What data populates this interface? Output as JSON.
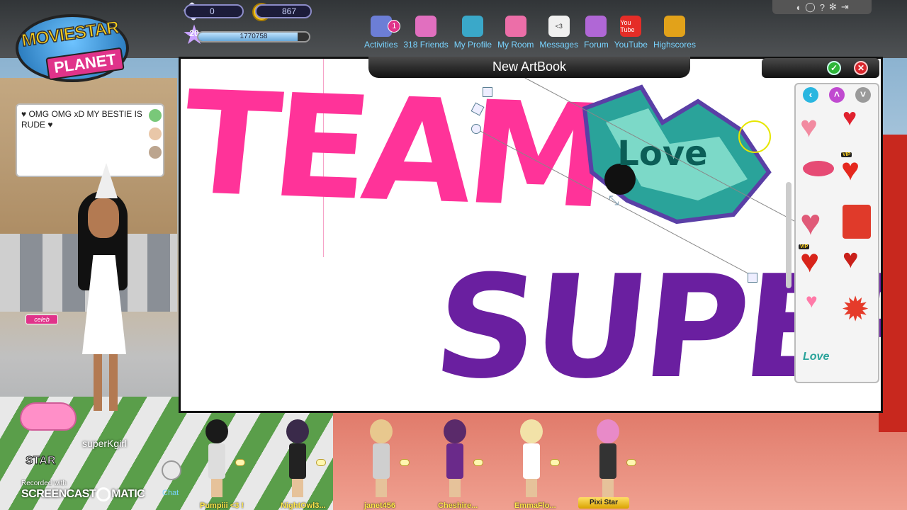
{
  "hud": {
    "logo_line1": "MOVIESTAR",
    "logo_line2": "PLANET",
    "diamonds": "0",
    "coins": "867",
    "level": "20",
    "fame": "1770758",
    "fame_progress": 0.9
  },
  "nav": {
    "items": [
      {
        "label": "Activities",
        "icon": "checklist-icon",
        "color": "#6c7ed6",
        "badge": "1"
      },
      {
        "label": "318 Friends",
        "icon": "friends-icon",
        "color": "#e16fbf"
      },
      {
        "label": "My Profile",
        "icon": "profile-book-icon",
        "color": "#3aa8c9"
      },
      {
        "label": "My Room",
        "icon": "house-icon",
        "color": "#ec6ea8"
      },
      {
        "label": "Messages",
        "icon": "speech-bubble-icon",
        "color": "#f0f0f0",
        "glyph": "<3"
      },
      {
        "label": "Forum",
        "icon": "forum-icon",
        "color": "#b067d6"
      },
      {
        "label": "YouTube",
        "icon": "youtube-icon",
        "color": "#e52d27",
        "glyph": "You Tube"
      },
      {
        "label": "Highscores",
        "icon": "trophy-icon",
        "color": "#e2a21a"
      }
    ]
  },
  "chat": {
    "message": "♥ OMG OMG xD MY BESTIE IS RUDE ♥"
  },
  "player": {
    "name": "superKgirl",
    "celeb_tag": "celeb",
    "star_label": "STAR"
  },
  "recorder": {
    "line1": "Recorded with",
    "line2_a": "SCREENCAST",
    "line2_b": "MATIC"
  },
  "chat_button": {
    "label": "Chat"
  },
  "crowd": [
    {
      "name": "Pumpiii <3 !"
    },
    {
      "name": "NightOwl3..."
    },
    {
      "name": "janet456"
    },
    {
      "name": "Cheshire..."
    },
    {
      "name": "EmmaFlo..."
    },
    {
      "name": "Pixi Star"
    }
  ],
  "artbook": {
    "title": "New ArtBook",
    "word1": "TEAM",
    "word2": "SUPER",
    "sticker_text": "Love",
    "ok_glyph": "✓",
    "close_glyph": "✕",
    "vip_label": "VIP"
  },
  "colors": {
    "team": "#ff3399",
    "super": "#6a1fa0",
    "accent_blue": "#79d4ff"
  }
}
